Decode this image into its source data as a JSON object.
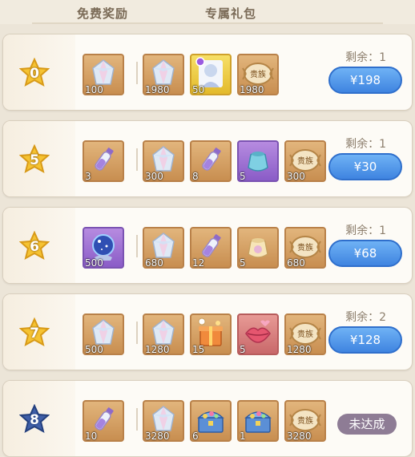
{
  "tabs": {
    "free": "免费奖励",
    "gift": "专属礼包"
  },
  "remain_prefix": "剩余：",
  "rows": [
    {
      "level": "0",
      "remain": "1",
      "price": "¥198",
      "free_item": {
        "qty": "100",
        "icon": "crystal-icon",
        "bg": "brown"
      },
      "items": [
        {
          "qty": "1980",
          "icon": "crystal-icon",
          "bg": "brown"
        },
        {
          "qty": "50",
          "icon": "character-card-icon",
          "bg": "yellow"
        },
        {
          "qty": "1980",
          "icon": "noble-emblem-icon",
          "bg": "brown"
        }
      ]
    },
    {
      "level": "5",
      "remain": "1",
      "price": "¥30",
      "free_item": {
        "qty": "3",
        "icon": "vial-icon",
        "bg": "brown"
      },
      "items": [
        {
          "qty": "300",
          "icon": "crystal-icon",
          "bg": "brown"
        },
        {
          "qty": "8",
          "icon": "vial-icon",
          "bg": "brown"
        },
        {
          "qty": "5",
          "icon": "pouch-icon",
          "bg": "purple"
        },
        {
          "qty": "300",
          "icon": "noble-emblem-icon",
          "bg": "brown"
        }
      ]
    },
    {
      "level": "6",
      "remain": "1",
      "price": "¥68",
      "free_item": {
        "qty": "500",
        "icon": "orb-icon",
        "bg": "purple"
      },
      "items": [
        {
          "qty": "680",
          "icon": "crystal-icon",
          "bg": "brown"
        },
        {
          "qty": "12",
          "icon": "vial-icon",
          "bg": "brown"
        },
        {
          "qty": "5",
          "icon": "pouch-icon",
          "bg": "brown"
        },
        {
          "qty": "680",
          "icon": "noble-emblem-icon",
          "bg": "brown"
        }
      ]
    },
    {
      "level": "7",
      "remain": "2",
      "price": "¥128",
      "free_item": {
        "qty": "500",
        "icon": "crystal-icon",
        "bg": "brown"
      },
      "items": [
        {
          "qty": "1280",
          "icon": "crystal-icon",
          "bg": "brown"
        },
        {
          "qty": "15",
          "icon": "gift-box-icon",
          "bg": "brown"
        },
        {
          "qty": "5",
          "icon": "lips-icon",
          "bg": "pink"
        },
        {
          "qty": "1280",
          "icon": "noble-emblem-icon",
          "bg": "brown"
        }
      ]
    },
    {
      "level": "8",
      "remain": "",
      "price": "",
      "status": "未达成",
      "free_item": {
        "qty": "10",
        "icon": "vial-icon",
        "bg": "brown"
      },
      "items": [
        {
          "qty": "3280",
          "icon": "crystal-icon",
          "bg": "brown"
        },
        {
          "qty": "6",
          "icon": "treasure-chest-icon",
          "bg": "brown"
        },
        {
          "qty": "1",
          "icon": "treasure-chest-icon",
          "bg": "brown"
        },
        {
          "qty": "3280",
          "icon": "noble-emblem-icon",
          "bg": "brown"
        }
      ]
    }
  ]
}
